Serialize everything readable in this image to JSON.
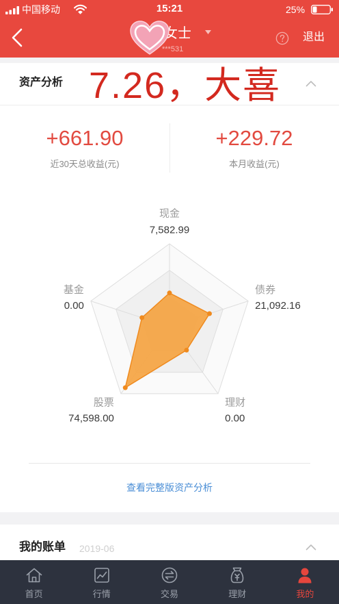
{
  "status_bar": {
    "carrier": "中国移动",
    "time": "15:21",
    "battery_text": "25%",
    "battery_level": 0.25
  },
  "nav": {
    "name": "女士",
    "account": "***531",
    "logout_label": "退出"
  },
  "asset_analysis": {
    "title": "资产分析",
    "annotation": "7.26，大喜",
    "stats": [
      {
        "value": "+661.90",
        "label": "近30天总收益(元)"
      },
      {
        "value": "+229.72",
        "label": "本月收益(元)"
      }
    ],
    "full_report_link": "查看完整版资产分析"
  },
  "bill": {
    "title": "我的账单",
    "month": "2019-06"
  },
  "tabs": [
    {
      "label": "首页",
      "icon": "home-icon",
      "active": false
    },
    {
      "label": "行情",
      "icon": "market-chart-icon",
      "active": false
    },
    {
      "label": "交易",
      "icon": "exchange-icon",
      "active": false
    },
    {
      "label": "理财",
      "icon": "money-bag-icon",
      "active": false
    },
    {
      "label": "我的",
      "icon": "person-icon",
      "active": true
    }
  ],
  "colors": {
    "brand_red": "#e8483e",
    "annotation_red": "#d3291f",
    "gain_red": "#e24a40",
    "link_blue": "#4a8ed6",
    "tab_bar": "#2d323e",
    "tab_active": "#e5463d",
    "radar_fill": "#f5a442",
    "radar_line": "#ef8a1e"
  },
  "chart_data": {
    "type": "radar",
    "categories": [
      "现金",
      "债券",
      "理财",
      "股票",
      "基金"
    ],
    "values": [
      7582.99,
      21092.16,
      0,
      74598.0,
      0
    ],
    "value_labels": [
      "7,582.99",
      "21,092.16",
      "0.00",
      "74,598.00",
      "0.00"
    ]
  }
}
